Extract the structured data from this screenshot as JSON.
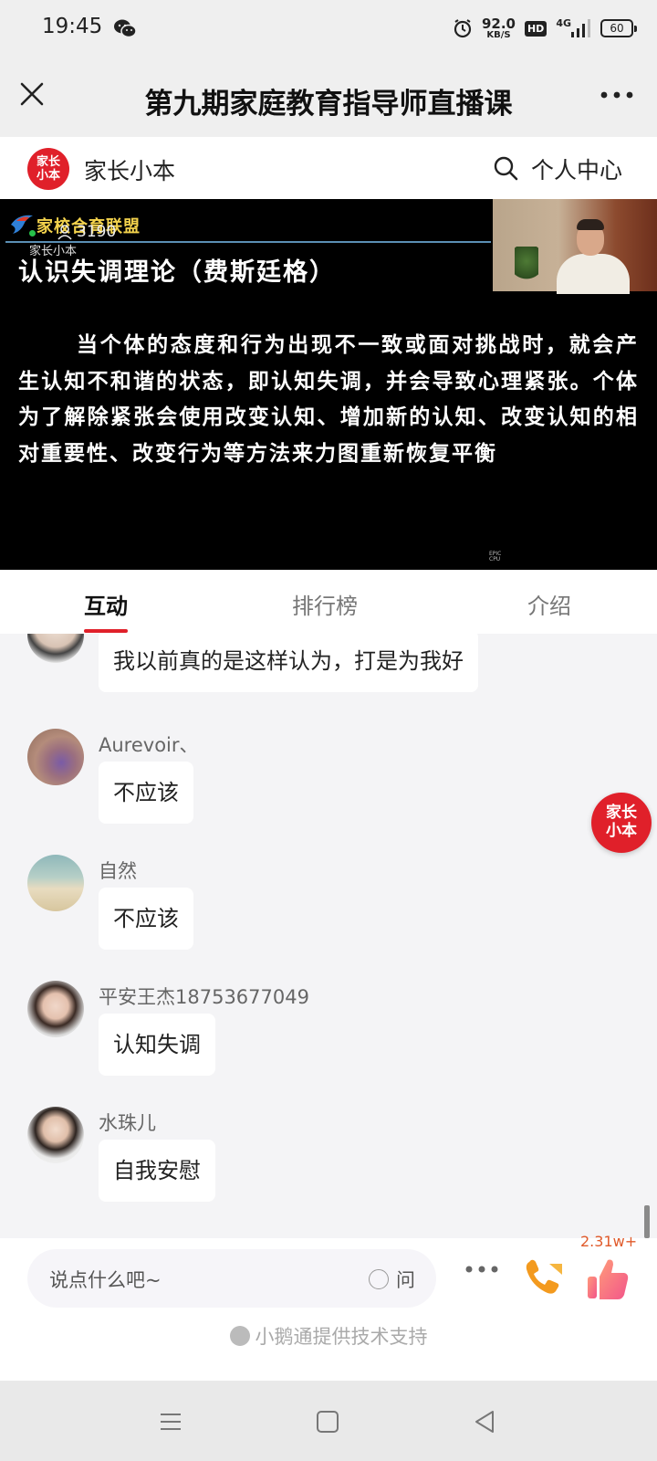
{
  "status": {
    "time": "19:45",
    "speed_value": "92.0",
    "speed_unit": "KB/S",
    "hd": "HD",
    "network": "4G",
    "battery": "60"
  },
  "header": {
    "title": "第九期家庭教育指导师直播课"
  },
  "brand": {
    "logo_text": "家长小本",
    "name": "家长小本",
    "personal_center": "个人中心"
  },
  "video": {
    "logo_text": "家校合育联盟",
    "sub_label": "家长小本",
    "viewers": "3190",
    "heading": "认识失调理论（费斯廷格）",
    "body": "当个体的态度和行为出现不一致或面对挑战时，就会产生认知不和谐的状态，即认知失调，并会导致心理紧张。个体为了解除紧张会使用改变认知、增加新的认知、改变认知的相对重要性、改变行为等方法来力图重新恢复平衡",
    "watermark_1": "EPIC",
    "watermark_2": "CPU"
  },
  "tabs": [
    {
      "label": "互动",
      "active": true
    },
    {
      "label": "排行榜",
      "active": false
    },
    {
      "label": "介绍",
      "active": false
    }
  ],
  "messages": [
    {
      "nickname": "",
      "text": "我以前真的是这样认为，打是为我好"
    },
    {
      "nickname": "Aurevoir、",
      "text": "不应该"
    },
    {
      "nickname": "自然",
      "text": "不应该"
    },
    {
      "nickname": "平安王杰18753677049",
      "text": "认知失调"
    },
    {
      "nickname": "水珠儿",
      "text": "自我安慰"
    }
  ],
  "float_logo_text": "家长小本",
  "input": {
    "placeholder": "说点什么吧~",
    "ask_label": "问",
    "like_count": "2.31w+"
  },
  "powered_by": "小鹅通提供技术支持",
  "colors": {
    "brand_red": "#e0202a",
    "tab_indicator": "#e0202a",
    "like_count": "#e05a2a"
  },
  "icons": [
    "wechat-icon",
    "alarm-icon",
    "signal-icon",
    "close-icon",
    "more-icon",
    "search-icon",
    "viewers-icon",
    "phone-icon",
    "like-icon",
    "menu-icon",
    "home-icon",
    "back-icon"
  ]
}
